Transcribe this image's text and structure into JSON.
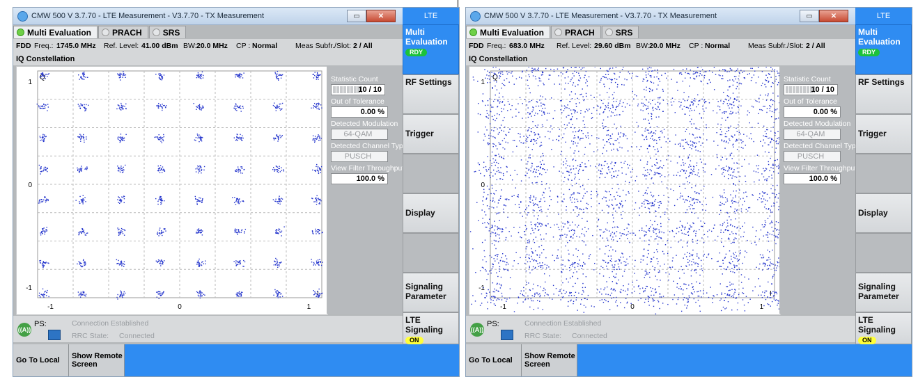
{
  "panels": [
    {
      "title": "CMW 500 V 3.7.70 - LTE Measurement  - V3.7.70 - TX Measurement",
      "lte_label": "LTE",
      "tabs": [
        "Multi Evaluation",
        "PRACH",
        "SRS"
      ],
      "info": {
        "duplex": "FDD",
        "freq_label": "Freq.:",
        "freq_value": "1745.0 MHz",
        "ref_label": "Ref. Level:",
        "ref_value": "41.00 dBm",
        "bw_label": "BW:",
        "bw_value": "20.0 MHz",
        "cp_label": "CP :",
        "cp_value": "Normal",
        "subfr_label": "Meas Subfr./Slot:",
        "subfr_value": "2  / All"
      },
      "section_title": "IQ Constellation",
      "plot": {
        "y_axis": "Q",
        "x_axis": "I",
        "x_ticks": [
          "-1",
          "0",
          "1"
        ],
        "y_ticks": [
          "1",
          "0",
          "-1"
        ],
        "spread": "tight"
      },
      "side": {
        "stat_count_label": "Statistic Count",
        "stat_count_value": "10 / 10",
        "oot_label": "Out of Tolerance",
        "oot_value": "0.00  %",
        "mod_label": "Detected Modulation",
        "mod_value": "64-QAM",
        "chtype_label": "Detected Channel Type",
        "chtype_value": "PUSCH",
        "vft_label": "View Filter Throughput",
        "vft_value": "100.0  %"
      },
      "status": {
        "ps_label": "PS:",
        "connection": "Connection Established",
        "rrc_label": "RRC State:",
        "rrc_value": "Connected"
      },
      "softkeys": {
        "multi_eval": "Multi Evaluation",
        "rdy": "RDY",
        "rf": "RF Settings",
        "trigger": "Trigger",
        "display": "Display",
        "signaling": "Signaling Parameter",
        "lte_sig": "LTE Signaling",
        "on": "ON"
      },
      "bottom": {
        "go_local": "Go To Local",
        "remote": "Show Remote Screen"
      }
    },
    {
      "title": "CMW 500 V 3.7.70 - LTE Measurement  - V3.7.70 - TX Measurement",
      "lte_label": "LTE",
      "tabs": [
        "Multi Evaluation",
        "PRACH",
        "SRS"
      ],
      "info": {
        "duplex": "FDD",
        "freq_label": "Freq.:",
        "freq_value": "683.0 MHz",
        "ref_label": "Ref. Level:",
        "ref_value": "29.60 dBm",
        "bw_label": "BW:",
        "bw_value": "20.0 MHz",
        "cp_label": "CP :",
        "cp_value": "Normal",
        "subfr_label": "Meas Subfr./Slot:",
        "subfr_value": "2  / All"
      },
      "section_title": "IQ Constellation",
      "plot": {
        "y_axis": "Q",
        "x_axis": "I",
        "x_ticks": [
          "-1",
          "0",
          "1"
        ],
        "y_ticks": [
          "1",
          "0",
          "-1"
        ],
        "spread": "wide"
      },
      "side": {
        "stat_count_label": "Statistic Count",
        "stat_count_value": "10 / 10",
        "oot_label": "Out of Tolerance",
        "oot_value": "0.00  %",
        "mod_label": "Detected Modulation",
        "mod_value": "64-QAM",
        "chtype_label": "Detected Channel Type",
        "chtype_value": "PUSCH",
        "vft_label": "View Filter Throughput",
        "vft_value": "100.0  %"
      },
      "status": {
        "ps_label": "PS:",
        "connection": "Connection Established",
        "rrc_label": "RRC State:",
        "rrc_value": "Connected"
      },
      "softkeys": {
        "multi_eval": "Multi Evaluation",
        "rdy": "RDY",
        "rf": "RF Settings",
        "trigger": "Trigger",
        "display": "Display",
        "signaling": "Signaling Parameter",
        "lte_sig": "LTE Signaling",
        "on": "ON"
      },
      "bottom": {
        "go_local": "Go To Local",
        "remote": "Show Remote Screen"
      }
    }
  ],
  "colors": {
    "accent": "#2f8cf2",
    "rdy": "#1cc23a",
    "on": "#ffff3a",
    "scatter": "#2233cc"
  }
}
